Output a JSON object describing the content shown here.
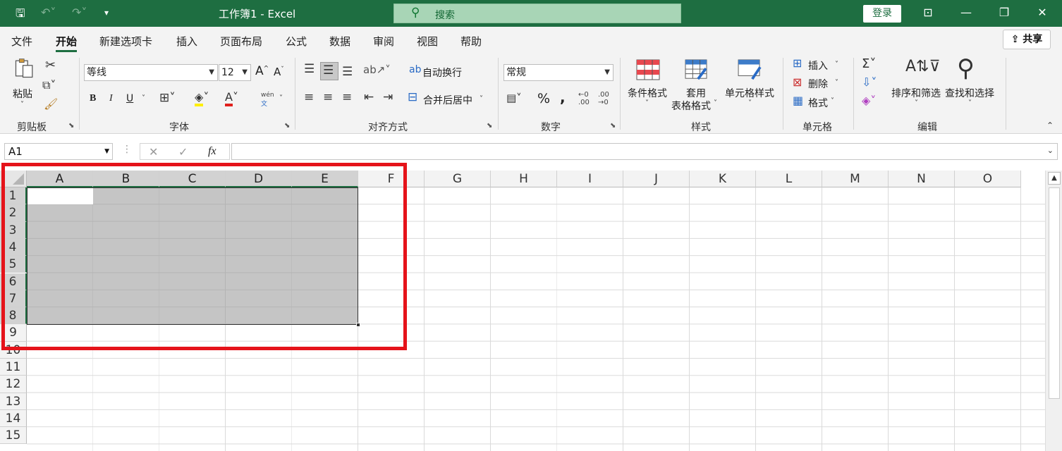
{
  "titlebar": {
    "title": "工作簿1  -  Excel",
    "search_placeholder": "搜索",
    "login_label": "登录",
    "colors": {
      "background": "#1e6e41",
      "search_bg": "#a8d5b6"
    }
  },
  "menu": {
    "tabs": [
      "文件",
      "开始",
      "新建选项卡",
      "插入",
      "页面布局",
      "公式",
      "数据",
      "审阅",
      "视图",
      "帮助"
    ],
    "active_tab": "开始",
    "share_label": "共享"
  },
  "ribbon": {
    "clipboard": {
      "paste_label": "粘贴",
      "group_label": "剪贴板"
    },
    "font": {
      "font_name": "等线",
      "font_size": "12",
      "group_label": "字体",
      "bold": "B",
      "italic": "I",
      "underline": "U",
      "grow": "A",
      "shrink": "A",
      "phonetic_top": "wén",
      "phonetic_bottom": "文"
    },
    "alignment": {
      "wrap_label": "自动换行",
      "merge_label": "合并后居中",
      "group_label": "对齐方式"
    },
    "number": {
      "format": "常规",
      "group_label": "数字",
      "percent": "%",
      "comma": ",",
      "increase_decimal": ".00",
      "decrease_decimal": ".00"
    },
    "styles": {
      "conditional_label": "条件格式",
      "table_label_1": "套用",
      "table_label_2": "表格格式",
      "cell_styles_label": "单元格样式",
      "group_label": "样式"
    },
    "cells": {
      "insert_label": "插入",
      "delete_label": "删除",
      "format_label": "格式",
      "group_label": "单元格"
    },
    "editing": {
      "sort_label": "排序和筛选",
      "find_label": "查找和选择",
      "group_label": "编辑"
    }
  },
  "formula_bar": {
    "name_box": "A1",
    "fx": "fx",
    "formula": ""
  },
  "sheet": {
    "columns": [
      "A",
      "B",
      "C",
      "D",
      "E",
      "F",
      "G",
      "H",
      "I",
      "J",
      "K",
      "L",
      "M",
      "N",
      "O"
    ],
    "rows": [
      "1",
      "2",
      "3",
      "4",
      "5",
      "6",
      "7",
      "8",
      "9",
      "10",
      "11",
      "12",
      "13",
      "14",
      "15"
    ],
    "selected_range": "A1:E8",
    "highlight_color": "#e5131a"
  }
}
